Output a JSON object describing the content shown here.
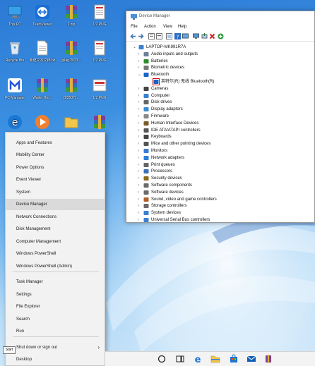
{
  "desktop": {
    "icons": [
      {
        "label": "This PC",
        "icon": "monitor-icon"
      },
      {
        "label": "TeamViewer",
        "icon": "teamviewer-icon"
      },
      {
        "label": "2.zip",
        "icon": "winrar-icon"
      },
      {
        "label": "1/2.PNG",
        "icon": "image-file-icon"
      },
      {
        "label": "Recycle Bin",
        "icon": "recycle-bin-icon"
      },
      {
        "label": "新建文本文档.txt",
        "icon": "text-file-icon"
      },
      {
        "label": "jplag.2023...",
        "icon": "winrar-icon"
      },
      {
        "label": "1/2.PNG",
        "icon": "image-file-icon"
      },
      {
        "label": "PC Manager",
        "icon": "pc-manager-icon"
      },
      {
        "label": "Wallet_ffm...",
        "icon": "winrar-icon"
      },
      {
        "label": "2025071...",
        "icon": "winrar-icon"
      },
      {
        "label": "1/2.PNG",
        "icon": "image-file-icon"
      },
      {
        "label": "",
        "icon": "edge-icon"
      },
      {
        "label": "",
        "icon": "media-icon"
      },
      {
        "label": "",
        "icon": "folder-icon"
      },
      {
        "label": "d",
        "icon": "winrar-icon"
      }
    ]
  },
  "start_menu": {
    "items": [
      "Apps and Features",
      "Mobility Center",
      "Power Options",
      "Event Viewer",
      "System",
      "Device Manager",
      "Network Connections",
      "Disk Management",
      "Computer Management",
      "Windows PowerShell",
      "Windows PowerShell (Admin)",
      "Task Manager",
      "Settings",
      "File Explorer",
      "Search",
      "Run",
      "Shut down or sign out",
      "Desktop"
    ],
    "highlighted": "Device Manager"
  },
  "start_tooltip": "Start",
  "device_manager": {
    "title": "Device Manager",
    "menu": [
      "File",
      "Action",
      "View",
      "Help"
    ],
    "tree": {
      "root": "LAPTOP-MK991R7A",
      "nodes": [
        {
          "label": "Audio inputs and outputs",
          "expanded": false
        },
        {
          "label": "Batteries",
          "expanded": false
        },
        {
          "label": "Biometric devices",
          "expanded": false
        },
        {
          "label": "Bluetooth",
          "expanded": true,
          "children": [
            "英特尔(R) 无线 Bluetooth(R)"
          ]
        },
        {
          "label": "Cameras",
          "expanded": false
        },
        {
          "label": "Computer",
          "expanded": false
        },
        {
          "label": "Disk drives",
          "expanded": false
        },
        {
          "label": "Display adaptors",
          "expanded": false
        },
        {
          "label": "Firmware",
          "expanded": false
        },
        {
          "label": "Human Interface Devices",
          "expanded": false
        },
        {
          "label": "IDE ATA/ATAPI controllers",
          "expanded": false
        },
        {
          "label": "Keyboards",
          "expanded": false
        },
        {
          "label": "Mice and other pointing devices",
          "expanded": false
        },
        {
          "label": "Monitors",
          "expanded": false
        },
        {
          "label": "Network adapters",
          "expanded": false
        },
        {
          "label": "Print queues",
          "expanded": false
        },
        {
          "label": "Processors",
          "expanded": false
        },
        {
          "label": "Security devices",
          "expanded": false
        },
        {
          "label": "Software components",
          "expanded": false
        },
        {
          "label": "Software devices",
          "expanded": false
        },
        {
          "label": "Sound, video and game controllers",
          "expanded": false
        },
        {
          "label": "Storage controllers",
          "expanded": false
        },
        {
          "label": "System devices",
          "expanded": false
        },
        {
          "label": "Universal Serial Bus controllers",
          "expanded": false
        }
      ]
    }
  },
  "colors": {
    "accent": "#0a64d6",
    "highlight_box": "#d00000",
    "menu_bg": "#f2f2f2"
  }
}
